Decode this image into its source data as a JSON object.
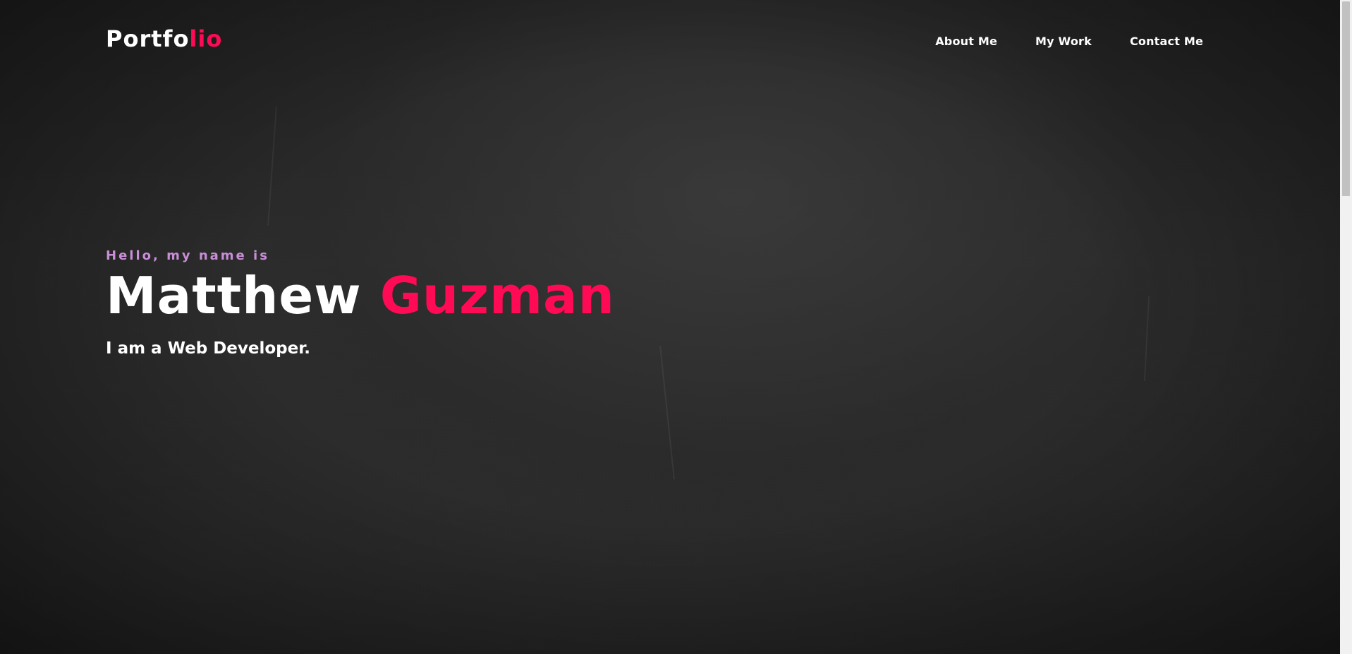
{
  "header": {
    "logo_main": "Portfo",
    "logo_accent": "lio",
    "nav": [
      {
        "label": "About Me"
      },
      {
        "label": "My Work"
      },
      {
        "label": "Contact Me"
      }
    ]
  },
  "hero": {
    "greeting": "Hello, my name is",
    "first_name": "Matthew",
    "last_name": "Guzman",
    "tagline": "I am a Web Developer."
  },
  "colors": {
    "accent": "#ff0a54",
    "greeting": "#c98ed6",
    "text": "#ffffff",
    "background": "#1c1c1c"
  }
}
